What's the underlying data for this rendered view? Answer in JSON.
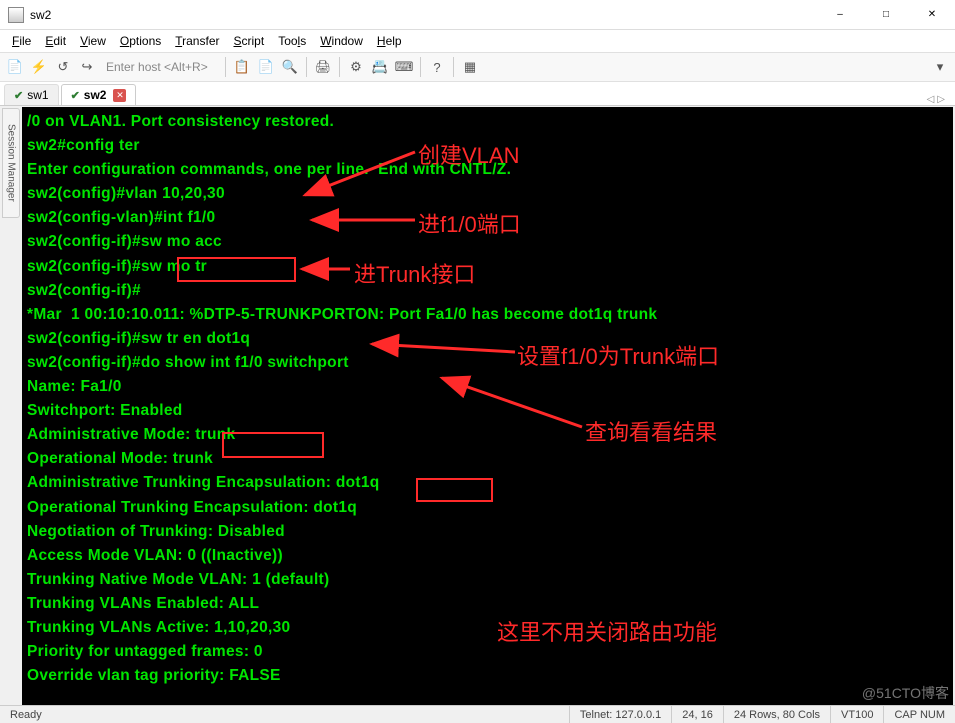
{
  "window": {
    "title": "sw2"
  },
  "menu": {
    "file": "File",
    "edit": "Edit",
    "view": "View",
    "options": "Options",
    "transfer": "Transfer",
    "script": "Script",
    "tools": "Tools",
    "window": "Window",
    "help": "Help"
  },
  "toolbar": {
    "host_placeholder": "Enter host <Alt+R>"
  },
  "tabs": [
    {
      "name": "sw1",
      "active": false
    },
    {
      "name": "sw2",
      "active": true
    }
  ],
  "sessmgr_label": "Session Manager",
  "terminal_lines": [
    "/0 on VLAN1. Port consistency restored.",
    "sw2#config ter",
    "Enter configuration commands, one per line.  End with CNTL/Z.",
    "sw2(config)#vlan 10,20,30",
    "sw2(config-vlan)#int f1/0",
    "sw2(config-if)#sw mo acc",
    "sw2(config-if)#sw mo tr",
    "sw2(config-if)#",
    "*Mar  1 00:10:10.011: %DTP-5-TRUNKPORTON: Port Fa1/0 has become dot1q trunk",
    "sw2(config-if)#sw tr en dot1q",
    "sw2(config-if)#do show int f1/0 switchport",
    "Name: Fa1/0",
    "Switchport: Enabled",
    "Administrative Mode: trunk",
    "Operational Mode: trunk",
    "Administrative Trunking Encapsulation: dot1q",
    "Operational Trunking Encapsulation: dot1q",
    "Negotiation of Trunking: Disabled",
    "Access Mode VLAN: 0 ((Inactive))",
    "Trunking Native Mode VLAN: 1 (default)",
    "Trunking VLANs Enabled: ALL",
    "Trunking VLANs Active: 1,10,20,30",
    "Priority for untagged frames: 0",
    "Override vlan tag priority: FALSE"
  ],
  "annotations": {
    "a1": "创建VLAN",
    "a2": "进f1/0端口",
    "a3": "进Trunk接口",
    "a4": "设置f1/0为Trunk端口",
    "a5": "查询看看结果",
    "a6": "这里不用关闭路由功能"
  },
  "status": {
    "ready": "Ready",
    "conn": "Telnet: 127.0.0.1",
    "pos": "24,  16",
    "size": "24 Rows, 80 Cols",
    "term": "VT100",
    "cap": "CAP  NUM"
  },
  "watermark": "@51CTO博客"
}
